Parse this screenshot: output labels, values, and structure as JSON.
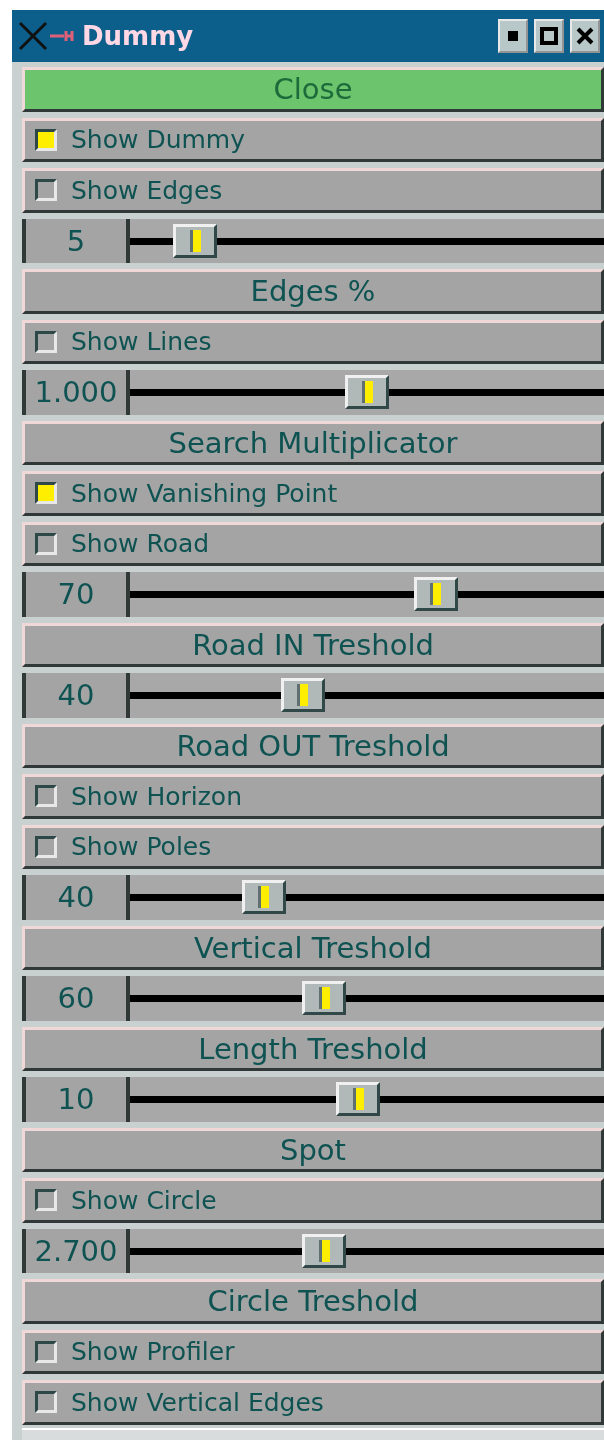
{
  "window": {
    "title": "Dummy"
  },
  "items": [
    {
      "kind": "button",
      "label": "Close"
    },
    {
      "kind": "checkbox",
      "label": "Show Dummy",
      "checked": true
    },
    {
      "kind": "checkbox",
      "label": "Show Edges",
      "checked": false
    },
    {
      "kind": "slider",
      "value": "5",
      "level": 0.1
    },
    {
      "kind": "label",
      "label": "Edges %"
    },
    {
      "kind": "checkbox",
      "label": "Show Lines",
      "checked": false
    },
    {
      "kind": "slider",
      "value": "1.000",
      "level": 0.5
    },
    {
      "kind": "label",
      "label": "Search Multiplicator"
    },
    {
      "kind": "checkbox",
      "label": "Show Vanishing Point",
      "checked": true
    },
    {
      "kind": "checkbox",
      "label": "Show Road",
      "checked": false
    },
    {
      "kind": "slider",
      "value": "70",
      "level": 0.66
    },
    {
      "kind": "label",
      "label": "Road IN Treshold"
    },
    {
      "kind": "slider",
      "value": "40",
      "level": 0.35
    },
    {
      "kind": "label",
      "label": "Road OUT Treshold"
    },
    {
      "kind": "checkbox",
      "label": "Show Horizon",
      "checked": false
    },
    {
      "kind": "checkbox",
      "label": "Show Poles",
      "checked": false
    },
    {
      "kind": "slider",
      "value": "40",
      "level": 0.26
    },
    {
      "kind": "label",
      "label": "Vertical Treshold"
    },
    {
      "kind": "slider",
      "value": "60",
      "level": 0.4
    },
    {
      "kind": "label",
      "label": "Length Treshold"
    },
    {
      "kind": "slider",
      "value": "10",
      "level": 0.48
    },
    {
      "kind": "label",
      "label": "Spot"
    },
    {
      "kind": "checkbox",
      "label": "Show Circle",
      "checked": false
    },
    {
      "kind": "slider",
      "value": "2.700",
      "level": 0.4
    },
    {
      "kind": "label",
      "label": "Circle Treshold"
    },
    {
      "kind": "checkbox",
      "label": "Show Profiler",
      "checked": false
    },
    {
      "kind": "checkbox",
      "label": "Show Vertical Edges",
      "checked": false
    }
  ]
}
